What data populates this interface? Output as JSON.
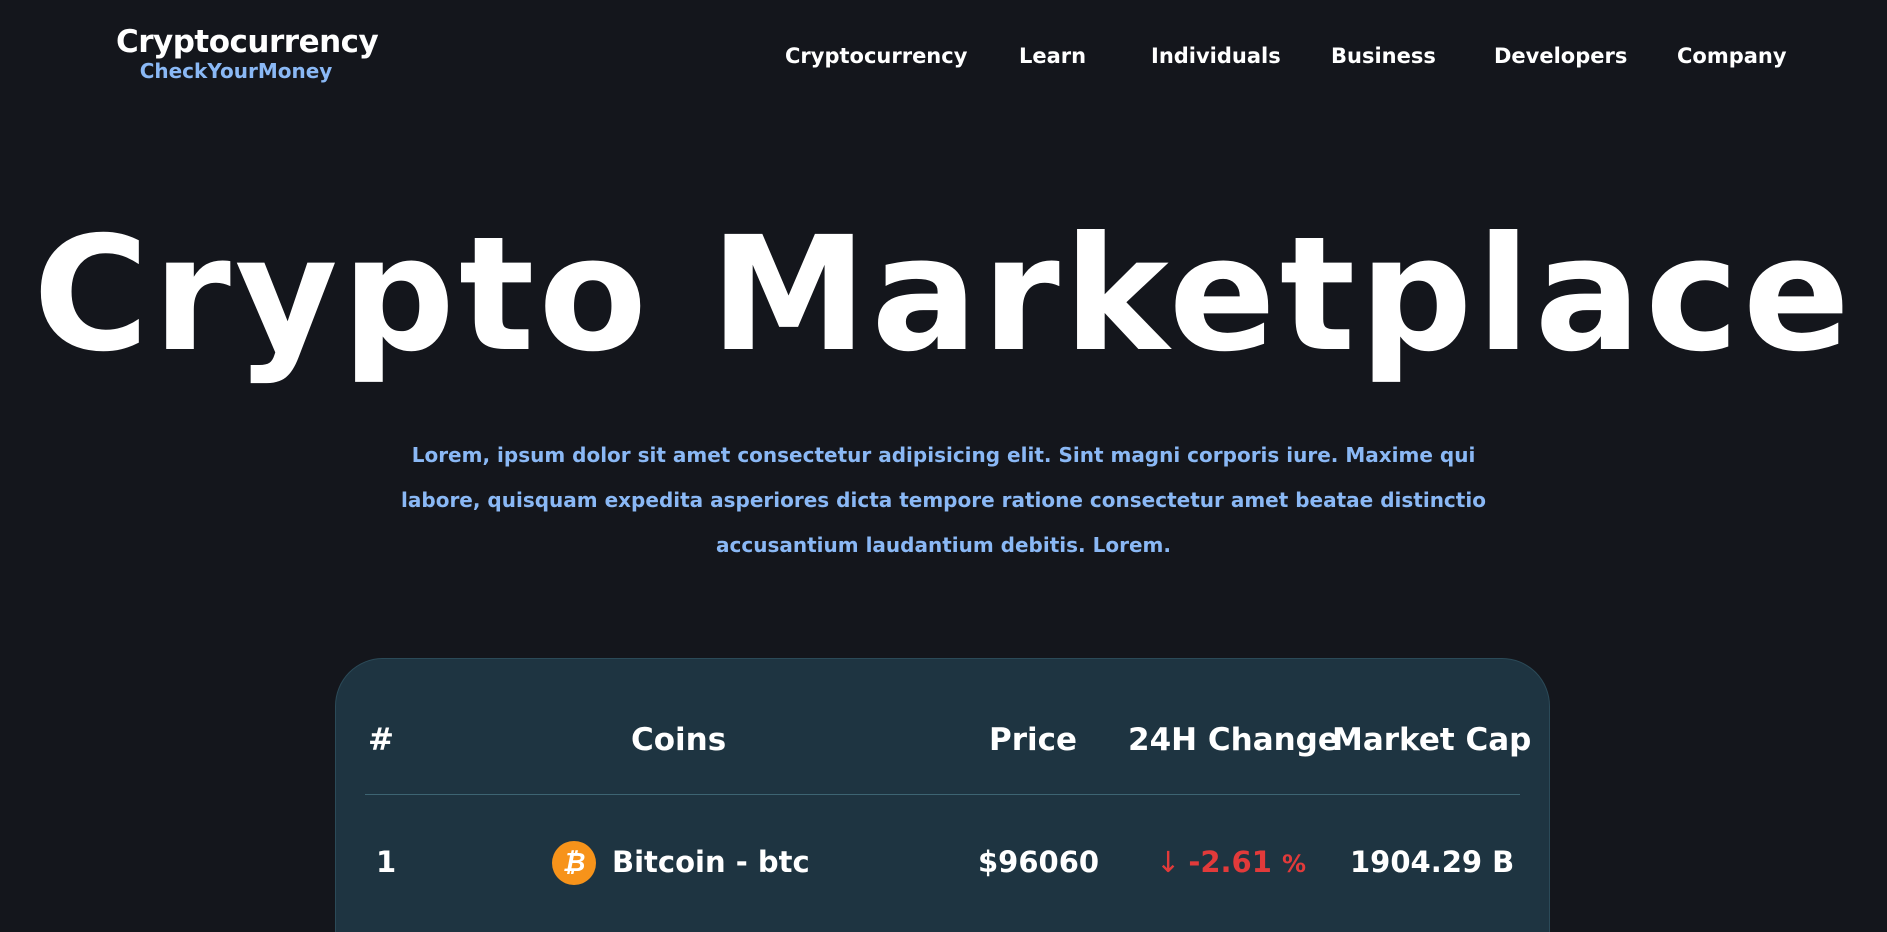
{
  "header": {
    "logo_title": "Cryptocurrency",
    "logo_subtitle": "CheckYourMoney",
    "nav": [
      {
        "label": "Cryptocurrency"
      },
      {
        "label": "Learn"
      },
      {
        "label": "Individuals"
      },
      {
        "label": "Business"
      },
      {
        "label": "Developers"
      },
      {
        "label": "Company"
      }
    ]
  },
  "hero": {
    "title": "Crypto Marketplace",
    "description": "Lorem, ipsum dolor sit amet consectetur adipisicing elit. Sint magni corporis iure. Maxime qui labore, quisquam expedita asperiores dicta tempore ratione consectetur amet beatae distinctio accusantium laudantium debitis. Lorem."
  },
  "table": {
    "headers": {
      "rank": "#",
      "coins": "Coins",
      "price": "Price",
      "change": "24H Change",
      "market_cap": "Market Cap"
    },
    "rows": [
      {
        "rank": "1",
        "coin": "Bitcoin - btc",
        "icon": "bitcoin-icon",
        "icon_glyph": "₿",
        "price": "$96060",
        "change_arrow": "↓",
        "change_value": "-2.61",
        "change_unit": "%",
        "market_cap": "1904.29 B"
      }
    ]
  },
  "colors": {
    "background": "#14161c",
    "accent": "#8ab8f5",
    "card": "#1e3441",
    "negative": "#e23a3a",
    "bitcoin": "#f7931a"
  }
}
